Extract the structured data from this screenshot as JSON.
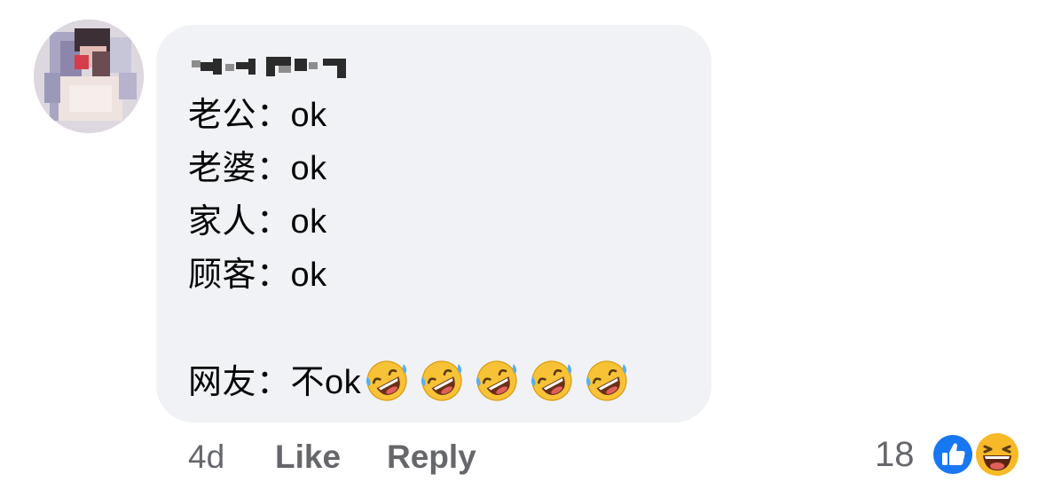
{
  "comment": {
    "lines": [
      "老公：ok",
      "老婆：ok",
      "家人：ok",
      "顾客：ok",
      "网友：不ok"
    ],
    "trailing_emoji": [
      "rofl-emoji",
      "rofl-emoji",
      "rofl-emoji",
      "rofl-emoji",
      "rofl-emoji"
    ],
    "timestamp": "4d",
    "like_label": "Like",
    "reply_label": "Reply",
    "reaction_count": "18",
    "reactions": [
      "like-reaction-icon",
      "haha-reaction-icon"
    ]
  },
  "colors": {
    "bubble": "#f0f2f5",
    "text": "#050505",
    "secondary": "#65676b",
    "like_blue": "#1877f2",
    "haha_yellow": "#f7b928"
  }
}
